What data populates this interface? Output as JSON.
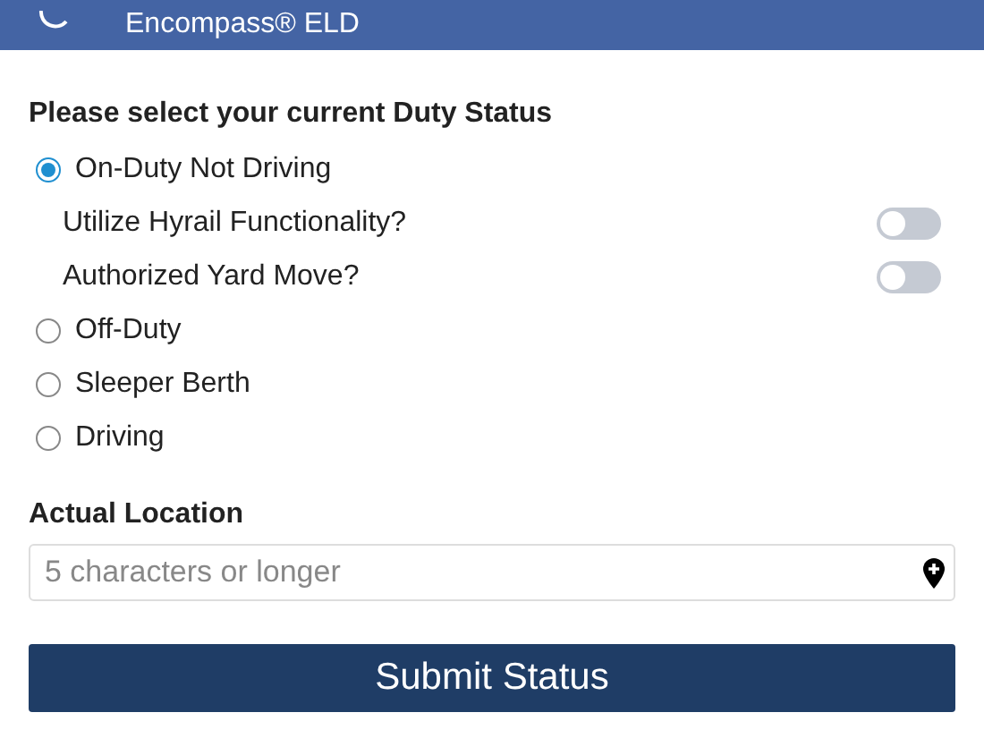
{
  "header": {
    "title": "Encompass® ELD"
  },
  "duty_status": {
    "heading": "Please select your current Duty Status",
    "options": [
      {
        "kind": "radio",
        "label": "On-Duty Not Driving",
        "selected": true
      },
      {
        "kind": "toggle",
        "label": "Utilize Hyrail Functionality?",
        "on": false
      },
      {
        "kind": "toggle",
        "label": "Authorized Yard Move?",
        "on": false
      },
      {
        "kind": "radio",
        "label": "Off-Duty",
        "selected": false
      },
      {
        "kind": "radio",
        "label": "Sleeper Berth",
        "selected": false
      },
      {
        "kind": "radio",
        "label": "Driving",
        "selected": false
      }
    ]
  },
  "location": {
    "label": "Actual Location",
    "placeholder": "5 characters or longer"
  },
  "submit_button": "Submit Status"
}
